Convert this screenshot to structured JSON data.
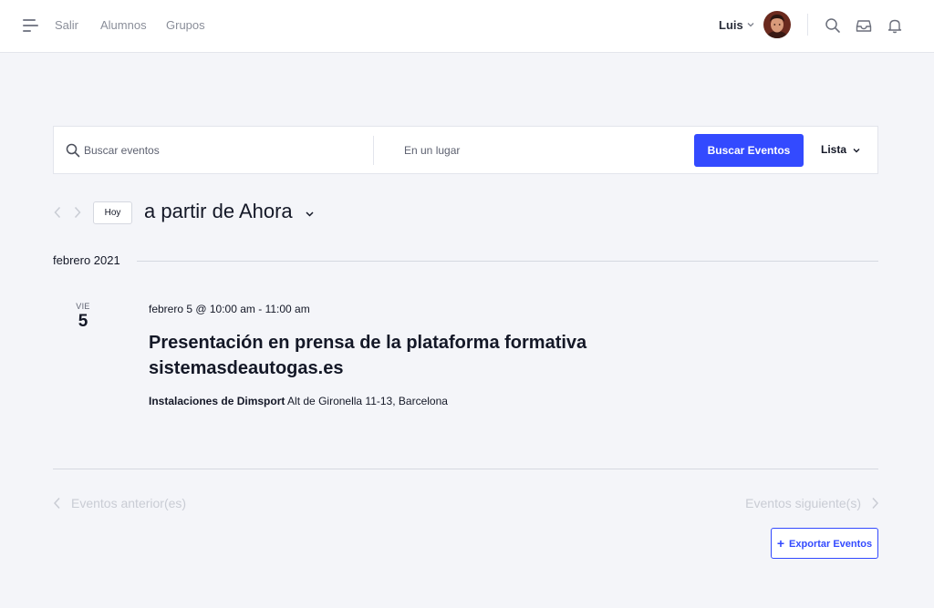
{
  "topbar": {
    "nav": [
      {
        "label": "Salir"
      },
      {
        "label": "Alumnos"
      },
      {
        "label": "Grupos"
      }
    ],
    "user": {
      "name": "Luis"
    }
  },
  "search": {
    "keyword_placeholder": "Buscar eventos",
    "location_placeholder": "En un lugar",
    "submit_label": "Buscar Eventos",
    "view_label": "Lista"
  },
  "datenav": {
    "today_label": "Hoy",
    "title": "a partir de Ahora"
  },
  "month": {
    "label": "febrero 2021"
  },
  "events": [
    {
      "weekday": "VIE",
      "day": "5",
      "datetime": "febrero 5 @ 10:00 am - 11:00 am",
      "title": "Presentación en prensa de la plataforma formativa sistemasdeautogas.es",
      "venue_name": "Instalaciones de Dimsport",
      "venue_address": "Alt de Gironella 11-13, Barcelona"
    }
  ],
  "pagination": {
    "prev_label": "Eventos anterior(es)",
    "next_label": "Eventos siguiente(s)"
  },
  "export": {
    "label": "Exportar Eventos"
  },
  "colors": {
    "accent": "#334aff",
    "background": "#f4f5f9",
    "text": "#141827",
    "muted": "#8a8e99",
    "disabled": "#c9ccd4"
  },
  "icons": {
    "menu": "menu-icon",
    "search": "search-icon",
    "inbox": "inbox-icon",
    "bell": "bell-icon",
    "chevron": "chevron-down-icon",
    "prev": "chevron-left-icon",
    "next": "chevron-right-icon",
    "plus": "plus-icon"
  }
}
